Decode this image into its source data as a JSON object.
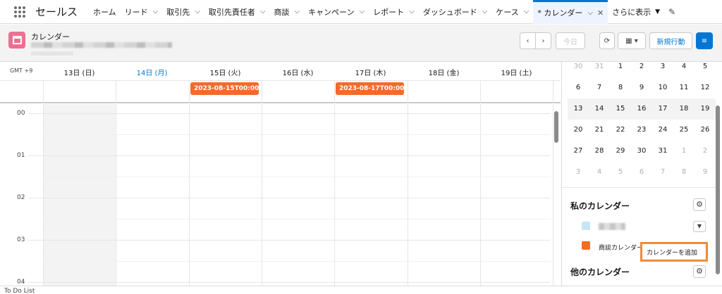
{
  "app": {
    "name": "セールス"
  },
  "nav": {
    "tabs": [
      {
        "label": "ホーム",
        "chev": false
      },
      {
        "label": "リード",
        "chev": true
      },
      {
        "label": "取引先",
        "chev": true
      },
      {
        "label": "取引先責任者",
        "chev": true
      },
      {
        "label": "商談",
        "chev": true
      },
      {
        "label": "キャンペーン",
        "chev": true
      },
      {
        "label": "レポート",
        "chev": true
      },
      {
        "label": "ダッシュボード",
        "chev": true
      },
      {
        "label": "ケース",
        "chev": true
      }
    ],
    "active_tab": "* カレンダー",
    "more_label": "さらに表示"
  },
  "header": {
    "title": "カレンダー",
    "today_label": "今日",
    "new_event_label": "新規行動"
  },
  "week": {
    "timezone": "GMT +9",
    "days": [
      {
        "label": "13日 (日)",
        "today": false
      },
      {
        "label": "14日 (月)",
        "today": true
      },
      {
        "label": "15日 (火)",
        "today": false
      },
      {
        "label": "16日 (水)",
        "today": false
      },
      {
        "label": "17日 (木)",
        "today": false
      },
      {
        "label": "18日 (金)",
        "today": false
      },
      {
        "label": "19日 (土)",
        "today": false
      }
    ],
    "events": [
      {
        "label": "2023-08-15T00:00:...",
        "day_index": 2
      },
      {
        "label": "2023-08-17T00:00:...",
        "day_index": 4
      }
    ],
    "hours": [
      "00",
      "01",
      "02",
      "03",
      "04"
    ]
  },
  "mini_calendar": {
    "weeks": [
      [
        "30",
        "31",
        "1",
        "2",
        "3",
        "4",
        "5"
      ],
      [
        "6",
        "7",
        "8",
        "9",
        "10",
        "11",
        "12"
      ],
      [
        "13",
        "14",
        "15",
        "16",
        "17",
        "18",
        "19"
      ],
      [
        "20",
        "21",
        "22",
        "23",
        "24",
        "25",
        "26"
      ],
      [
        "27",
        "28",
        "29",
        "30",
        "31",
        "1",
        "2"
      ],
      [
        "3",
        "4",
        "5",
        "6",
        "7",
        "8",
        "9"
      ]
    ]
  },
  "my_calendars": {
    "title": "私のカレンダー",
    "items": [
      {
        "label": "",
        "color": "#c7e5f8"
      },
      {
        "label": "商談カレンダー",
        "color": "#f56a28"
      }
    ],
    "add_tooltip": "カレンダーを追加"
  },
  "other_calendars": {
    "title": "他のカレンダー"
  },
  "footer": {
    "label": "To Do List"
  },
  "colors": {
    "brand": "#0176d3",
    "event": "#f56a28",
    "calendar_icon": "#eb7092"
  }
}
